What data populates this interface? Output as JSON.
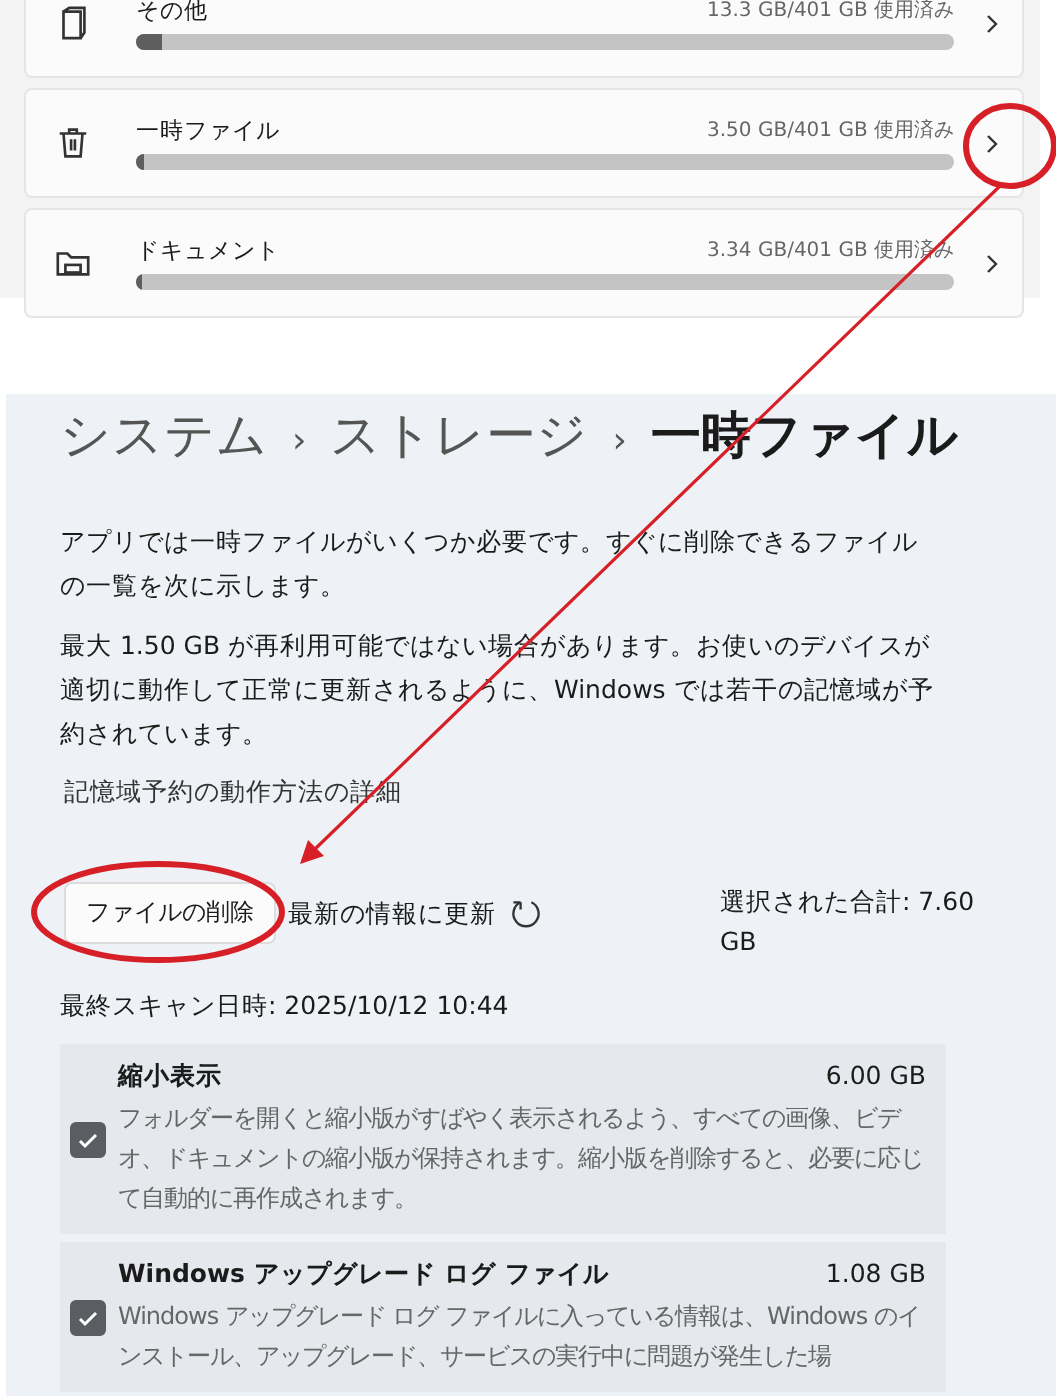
{
  "storage_categories": [
    {
      "kind": "other",
      "name": "その他",
      "usage": "13.3 GB/401 GB 使用済み",
      "level": 0.033
    },
    {
      "kind": "temp",
      "name": "一時ファイル",
      "usage": "3.50 GB/401 GB 使用済み",
      "level": 0.009
    },
    {
      "kind": "documents",
      "name": "ドキュメント",
      "usage": "3.34 GB/401 GB 使用済み",
      "level": 0.008
    }
  ],
  "breadcrumb": [
    "システム",
    "ストレージ",
    "一時ファイル"
  ],
  "breadcrumb_separator": "›",
  "intro": "アプリでは一時ファイルがいくつか必要です。すぐに削除できるファイルの一覧を次に示します。",
  "reserve_note": "最大 1.50 GB が再利用可能ではない場合があります。お使いのデバイスが適切に動作して正常に更新されるように、Windows では若干の記憶域が予約されています。",
  "learn_more_link": "記憶域予約の動作方法の詳細",
  "delete_button": "ファイルの削除",
  "refresh_button": "最新の情報に更新",
  "selected_total": "選択された合計: 7.60 GB",
  "last_scan": "最終スキャン日時: 2025/10/12 10:44",
  "items": [
    {
      "title": "縮小表示",
      "size": "6.00 GB",
      "description": "フォルダーを開くと縮小版がすばやく表示されるよう、すべての画像、ビデオ、ドキュメントの縮小版が保持されます。縮小版を削除すると、必要に応じて自動的に再作成されます。",
      "checked": true
    },
    {
      "title": "Windows アップグレード ログ ファイル",
      "size": "1.08 GB",
      "description": "Windows アップグレード ログ ファイルに入っている情報は、Windows のインストール、アップグレード、サービスの実行中に問題が発生した場",
      "checked": true
    }
  ]
}
